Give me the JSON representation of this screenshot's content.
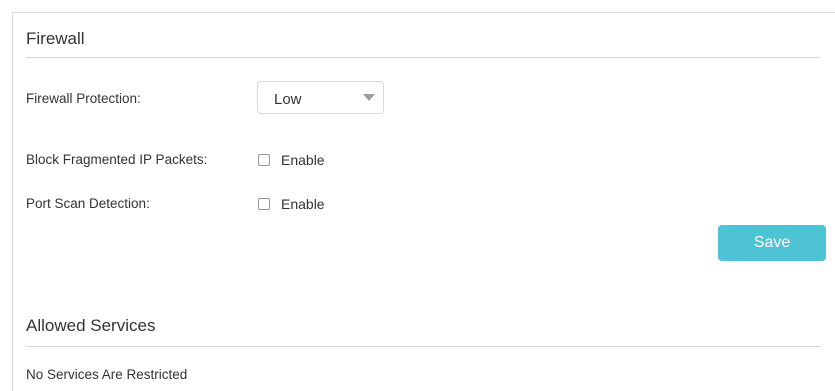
{
  "firewall": {
    "title": "Firewall",
    "protection": {
      "label": "Firewall Protection:",
      "selected": "Low"
    },
    "block_fragmented": {
      "label": "Block Fragmented IP Packets:",
      "checkbox_label": "Enable",
      "checked": false
    },
    "port_scan": {
      "label": "Port Scan Detection:",
      "checkbox_label": "Enable",
      "checked": false
    },
    "save_label": "Save"
  },
  "allowed_services": {
    "title": "Allowed Services",
    "message": "No Services Are Restricted"
  },
  "colors": {
    "accent": "#4ec3d4",
    "text": "#333333",
    "divider": "#d8d8d8"
  }
}
